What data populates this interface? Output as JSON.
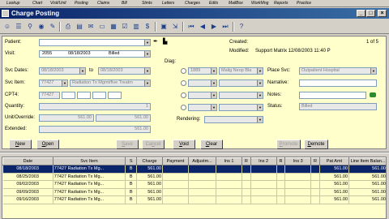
{
  "menubar": [
    "Lookup",
    "Chart",
    "Visit/Unit",
    "Posting",
    "Claims",
    "Bill",
    "Stmts",
    "Letters",
    "Charges",
    "Edits",
    "MailBox",
    "WorkMng",
    "Reports",
    "Practice"
  ],
  "window": {
    "title": "Charge Posting"
  },
  "form": {
    "patient_label": "Patient:",
    "visit_label": "Visit:",
    "visit_number": "2055",
    "visit_date": "08/18/2003",
    "visit_status": "Billed",
    "svc_dates_label": "Svc Dates:",
    "svc_from": "08/18/2003",
    "to_label": "to",
    "svc_to": "08/18/2003",
    "svc_item_label": "Svc Item:",
    "svc_item_code": "77427",
    "svc_item_desc": "Radiation Tx Mgmt/five Treatm",
    "cpt4_label": "CPT4:",
    "cpt4_value": "77427",
    "quantity_label": "Quantity:",
    "quantity_value": "1",
    "unit_override_label": "Unit/Override:",
    "unit_value": "561.00",
    "override_value": "561.00",
    "extended_label": "Extended:",
    "extended_value": "561.00",
    "diag_label": "Diag:",
    "diag_code": "1889",
    "diag_desc": "Malig Neop Bla",
    "rendering_label": "Rendering:",
    "created_label": "Created:",
    "record_counter": "1 of 5",
    "modified_label": "Modified:",
    "modified_value": "Support Matrix 12/08/2003 11:40 P",
    "place_svc_label": "Place Svc:",
    "place_svc_value": "Outpatient Hospital",
    "narrative_label": "Narrative:",
    "notes_label": "Notes:",
    "status_label": "Status:",
    "status_value": "Billed"
  },
  "buttons": {
    "new_pre": "",
    "new_u": "N",
    "new_post": "ew",
    "open_pre": "",
    "open_u": "O",
    "open_post": "pen",
    "save_pre": "",
    "save_u": "S",
    "save_post": "ave",
    "cancel_pre": "Ca",
    "cancel_u": "n",
    "cancel_post": "cel",
    "void_pre": "",
    "void_u": "V",
    "void_post": "oid",
    "clear_pre": "",
    "clear_u": "C",
    "clear_post": "lear",
    "promote_pre": "",
    "promote_u": "P",
    "promote_post": "romote",
    "demote_pre": "",
    "demote_u": "D",
    "demote_post": "emote"
  },
  "table": {
    "headers": [
      "Date",
      "Svc Item",
      "S",
      "Charge",
      "Payment",
      "Adjustm...",
      "Ins 1",
      "R",
      "Ins 2",
      "R",
      "Ins 3",
      "R",
      "Pat Amt",
      "Line Item Balan..."
    ],
    "rows": [
      [
        "08/18/2003",
        "77427 Radiation Tx Mg...",
        "B",
        "561.00",
        "",
        "",
        "",
        "",
        "",
        "",
        "",
        "",
        "561.00",
        "561.00"
      ],
      [
        "08/25/2003",
        "77427 Radiation Tx Mg...",
        "B",
        "561.00",
        "",
        "",
        "",
        "",
        "",
        "",
        "",
        "",
        "561.00",
        "561.00"
      ],
      [
        "09/02/2003",
        "77427 Radiation Tx Mg...",
        "B",
        "561.00",
        "",
        "",
        "",
        "",
        "",
        "",
        "",
        "",
        "561.00",
        "561.00"
      ],
      [
        "09/09/2003",
        "77427 Radiation Tx Mg...",
        "B",
        "561.00",
        "",
        "",
        "",
        "",
        "",
        "",
        "",
        "",
        "561.00",
        "561.00"
      ],
      [
        "09/16/2003",
        "77427 Radiation Tx Mg...",
        "B",
        "561.00",
        "",
        "",
        "",
        "",
        "",
        "",
        "",
        "",
        "561.00",
        "561.00"
      ]
    ]
  }
}
